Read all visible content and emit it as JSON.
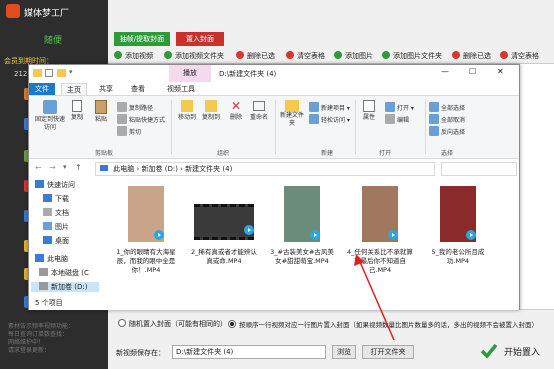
{
  "app": {
    "title": "媒体梦工厂",
    "user": "随便",
    "member_expiry": "会员到期时间：",
    "member_date": "2121-",
    "notice_lines": [
      "素材告示频率视频功能：",
      "每日查询订单数查找：",
      "网络维护中！",
      "请求登录更新：",
      "请求登录更新"
    ]
  },
  "top_buttons": {
    "extract_cover": "抽帧/提取封面",
    "import_cover": "置入封面"
  },
  "toolbar2": [
    {
      "label": "添加视频",
      "color": "#2e9a3a"
    },
    {
      "label": "添加视频文件夹",
      "color": "#2e9a3a"
    },
    {
      "label": "删除已选",
      "color": "#d9362f"
    },
    {
      "label": "清空表格",
      "color": "#d9362f"
    },
    {
      "label": "添加图片",
      "color": "#2e9a3a"
    },
    {
      "label": "添加图片文件夹",
      "color": "#2e9a3a"
    },
    {
      "label": "删除已选",
      "color": "#d9362f"
    },
    {
      "label": "清空表格",
      "color": "#d9362f"
    }
  ],
  "bottom": {
    "radio_random": "随机置入封面（可能有相同的）",
    "radio_order": "按顺序一行视频对应一行图片置入封面（如果视频数量比图片数量多的话，多出的视频不会被置入封面）",
    "save_label": "新视频保存在：",
    "save_path": "D:\\新建文件夹 (4)",
    "browse": "浏览",
    "open_folder": "打开文件夹",
    "start": "开始置入"
  },
  "explorer": {
    "title": "D:\\新建文件夹 (4)",
    "play_tab": "播放",
    "window_controls": [
      "—",
      "☐",
      "✕"
    ],
    "tabs": [
      "文件",
      "主页",
      "共享",
      "查看",
      "视频工具"
    ],
    "ribbon": {
      "pin_quick": "固定到快速访问",
      "copy": "复制",
      "paste": "粘贴",
      "copy_path": "复制路径",
      "paste_shortcut": "粘贴快捷方式",
      "cut": "剪切",
      "clipboard": "剪贴板",
      "move_to": "移动到",
      "copy_to": "复制到",
      "delete": "删除",
      "rename": "重命名",
      "organize": "组织",
      "new_folder": "新建文件夹",
      "new_item": "新建项目",
      "easy_access": "轻松访问",
      "new": "新建",
      "properties": "属性",
      "open": "打开",
      "edit": "编辑",
      "open_group": "打开",
      "select_all": "全部选择",
      "select_none": "全部取消",
      "invert": "反向选择",
      "select": "选择"
    },
    "breadcrumb": [
      "此电脑",
      "新加卷 (D:)",
      "新建文件夹 (4)"
    ],
    "nav": [
      "快速访问",
      "下载",
      "文档",
      "图片",
      "桌面",
      "此电脑",
      "本地磁盘 (C",
      "新加卷 (D:)"
    ],
    "files": [
      {
        "name": "1_你的眼睛有大海星辰，而我的眼中全是你！.MP4",
        "color": "#c9a38a"
      },
      {
        "name": "2_稀有真或者才能辨认真或命.MP4",
        "color": "#3a3a3a"
      },
      {
        "name": "3_#古装美女#古风美女#甜甜萌宝.MP4",
        "color": "#6b8c7a"
      },
      {
        "name": "4_任何关系比不承就算了最后你不知道自己.MP4",
        "color": "#a07860"
      },
      {
        "name": "5_我的老公所且成功.MP4",
        "color": "#8a2a2a"
      }
    ],
    "status": "5 个项目"
  }
}
